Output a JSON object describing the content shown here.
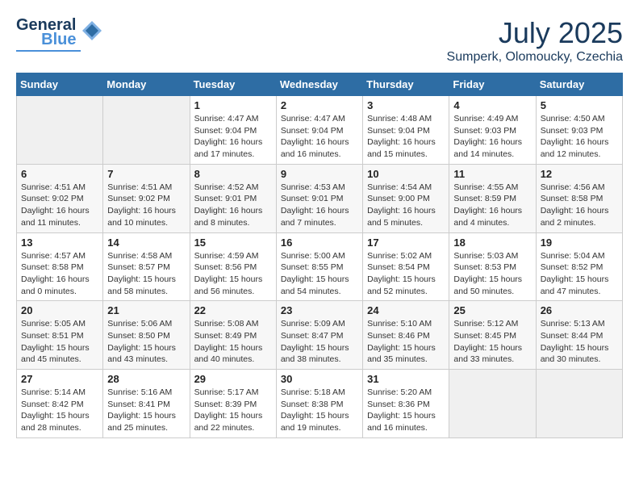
{
  "header": {
    "logo_line1": "General",
    "logo_line2": "Blue",
    "month": "July 2025",
    "location": "Sumperk, Olomoucky, Czechia"
  },
  "weekdays": [
    "Sunday",
    "Monday",
    "Tuesday",
    "Wednesday",
    "Thursday",
    "Friday",
    "Saturday"
  ],
  "weeks": [
    [
      {
        "day": "",
        "info": ""
      },
      {
        "day": "",
        "info": ""
      },
      {
        "day": "1",
        "info": "Sunrise: 4:47 AM\nSunset: 9:04 PM\nDaylight: 16 hours\nand 17 minutes."
      },
      {
        "day": "2",
        "info": "Sunrise: 4:47 AM\nSunset: 9:04 PM\nDaylight: 16 hours\nand 16 minutes."
      },
      {
        "day": "3",
        "info": "Sunrise: 4:48 AM\nSunset: 9:04 PM\nDaylight: 16 hours\nand 15 minutes."
      },
      {
        "day": "4",
        "info": "Sunrise: 4:49 AM\nSunset: 9:03 PM\nDaylight: 16 hours\nand 14 minutes."
      },
      {
        "day": "5",
        "info": "Sunrise: 4:50 AM\nSunset: 9:03 PM\nDaylight: 16 hours\nand 12 minutes."
      }
    ],
    [
      {
        "day": "6",
        "info": "Sunrise: 4:51 AM\nSunset: 9:02 PM\nDaylight: 16 hours\nand 11 minutes."
      },
      {
        "day": "7",
        "info": "Sunrise: 4:51 AM\nSunset: 9:02 PM\nDaylight: 16 hours\nand 10 minutes."
      },
      {
        "day": "8",
        "info": "Sunrise: 4:52 AM\nSunset: 9:01 PM\nDaylight: 16 hours\nand 8 minutes."
      },
      {
        "day": "9",
        "info": "Sunrise: 4:53 AM\nSunset: 9:01 PM\nDaylight: 16 hours\nand 7 minutes."
      },
      {
        "day": "10",
        "info": "Sunrise: 4:54 AM\nSunset: 9:00 PM\nDaylight: 16 hours\nand 5 minutes."
      },
      {
        "day": "11",
        "info": "Sunrise: 4:55 AM\nSunset: 8:59 PM\nDaylight: 16 hours\nand 4 minutes."
      },
      {
        "day": "12",
        "info": "Sunrise: 4:56 AM\nSunset: 8:58 PM\nDaylight: 16 hours\nand 2 minutes."
      }
    ],
    [
      {
        "day": "13",
        "info": "Sunrise: 4:57 AM\nSunset: 8:58 PM\nDaylight: 16 hours\nand 0 minutes."
      },
      {
        "day": "14",
        "info": "Sunrise: 4:58 AM\nSunset: 8:57 PM\nDaylight: 15 hours\nand 58 minutes."
      },
      {
        "day": "15",
        "info": "Sunrise: 4:59 AM\nSunset: 8:56 PM\nDaylight: 15 hours\nand 56 minutes."
      },
      {
        "day": "16",
        "info": "Sunrise: 5:00 AM\nSunset: 8:55 PM\nDaylight: 15 hours\nand 54 minutes."
      },
      {
        "day": "17",
        "info": "Sunrise: 5:02 AM\nSunset: 8:54 PM\nDaylight: 15 hours\nand 52 minutes."
      },
      {
        "day": "18",
        "info": "Sunrise: 5:03 AM\nSunset: 8:53 PM\nDaylight: 15 hours\nand 50 minutes."
      },
      {
        "day": "19",
        "info": "Sunrise: 5:04 AM\nSunset: 8:52 PM\nDaylight: 15 hours\nand 47 minutes."
      }
    ],
    [
      {
        "day": "20",
        "info": "Sunrise: 5:05 AM\nSunset: 8:51 PM\nDaylight: 15 hours\nand 45 minutes."
      },
      {
        "day": "21",
        "info": "Sunrise: 5:06 AM\nSunset: 8:50 PM\nDaylight: 15 hours\nand 43 minutes."
      },
      {
        "day": "22",
        "info": "Sunrise: 5:08 AM\nSunset: 8:49 PM\nDaylight: 15 hours\nand 40 minutes."
      },
      {
        "day": "23",
        "info": "Sunrise: 5:09 AM\nSunset: 8:47 PM\nDaylight: 15 hours\nand 38 minutes."
      },
      {
        "day": "24",
        "info": "Sunrise: 5:10 AM\nSunset: 8:46 PM\nDaylight: 15 hours\nand 35 minutes."
      },
      {
        "day": "25",
        "info": "Sunrise: 5:12 AM\nSunset: 8:45 PM\nDaylight: 15 hours\nand 33 minutes."
      },
      {
        "day": "26",
        "info": "Sunrise: 5:13 AM\nSunset: 8:44 PM\nDaylight: 15 hours\nand 30 minutes."
      }
    ],
    [
      {
        "day": "27",
        "info": "Sunrise: 5:14 AM\nSunset: 8:42 PM\nDaylight: 15 hours\nand 28 minutes."
      },
      {
        "day": "28",
        "info": "Sunrise: 5:16 AM\nSunset: 8:41 PM\nDaylight: 15 hours\nand 25 minutes."
      },
      {
        "day": "29",
        "info": "Sunrise: 5:17 AM\nSunset: 8:39 PM\nDaylight: 15 hours\nand 22 minutes."
      },
      {
        "day": "30",
        "info": "Sunrise: 5:18 AM\nSunset: 8:38 PM\nDaylight: 15 hours\nand 19 minutes."
      },
      {
        "day": "31",
        "info": "Sunrise: 5:20 AM\nSunset: 8:36 PM\nDaylight: 15 hours\nand 16 minutes."
      },
      {
        "day": "",
        "info": ""
      },
      {
        "day": "",
        "info": ""
      }
    ]
  ]
}
